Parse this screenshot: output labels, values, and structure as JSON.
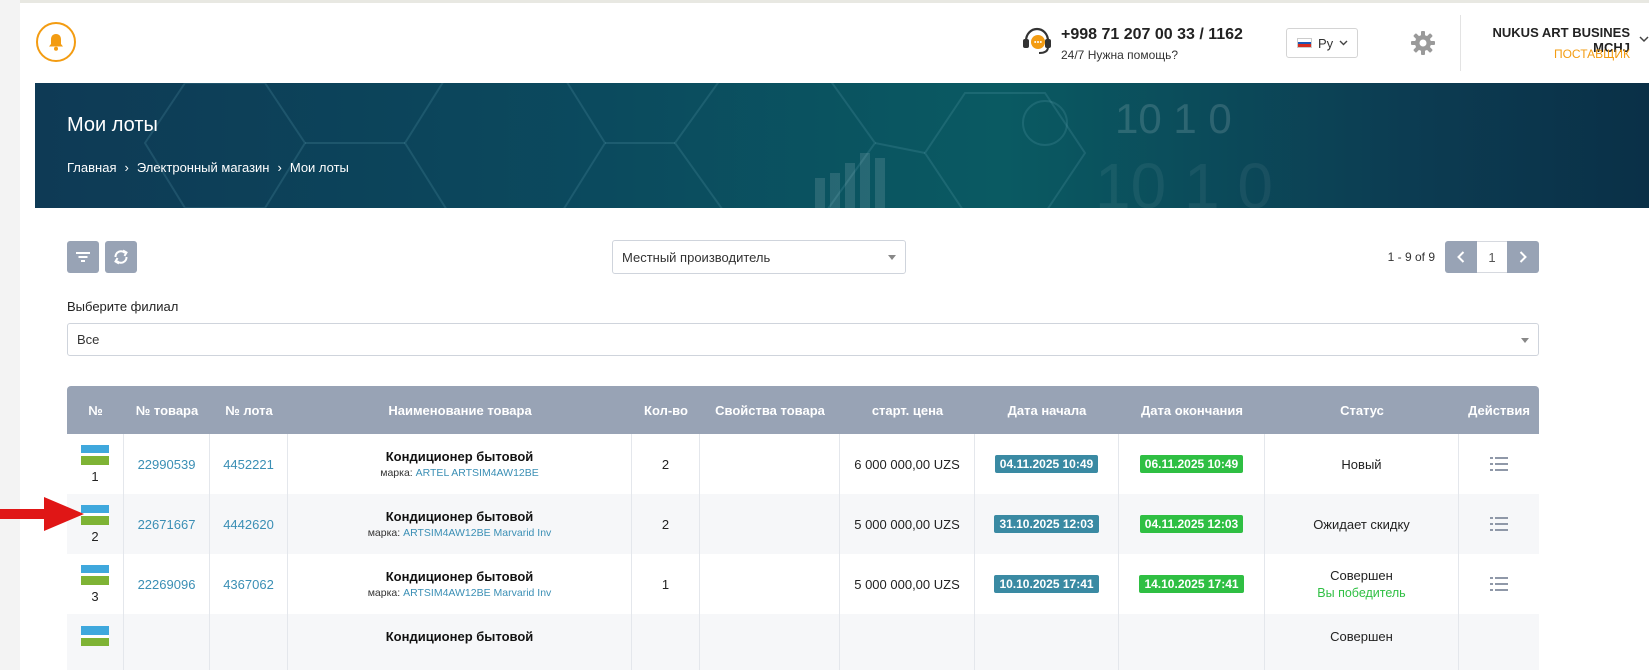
{
  "header": {
    "phone": "+998 71 207 00 33 / 1162",
    "help_text": "24/7 Нужна помощь?",
    "language": "Ру",
    "company": "NUKUS ART BUSINES MCHJ",
    "role": "ПОСТАВЩИК",
    "accent_color": "#f39c12"
  },
  "banner": {
    "title": "Мои лоты",
    "breadcrumbs": [
      "Главная",
      "Электронный магазин",
      "Мои лоты"
    ],
    "separator": "›",
    "decor_digits": "10 1 0"
  },
  "toolbar": {
    "filter_icon": "filter-icon",
    "refresh_icon": "refresh-icon",
    "producer_select": "Местный производитель",
    "pagination_info": "1 - 9 of 9",
    "current_page": "1"
  },
  "branch": {
    "label": "Выберите филиал",
    "value": "Все"
  },
  "table": {
    "columns": [
      "№",
      "№ товара",
      "№ лота",
      "Наименование товара",
      "Кол-во",
      "Свойства товара",
      "старт. цена",
      "Дата начала",
      "Дата окончания",
      "Статус",
      "Действия"
    ],
    "brand_prefix": "марка:",
    "rows": [
      {
        "num": "1",
        "item_no": "22990539",
        "lot_no": "4452221",
        "name": "Кондиционер бытовой",
        "brand": "ARTEL ARTSIM4AW12BE",
        "qty": "2",
        "props": "",
        "price": "6 000 000,00 UZS",
        "start": "04.11.2025 10:49",
        "end": "06.11.2025 10:49",
        "status": "Новый",
        "status_sub": ""
      },
      {
        "num": "2",
        "item_no": "22671667",
        "lot_no": "4442620",
        "name": "Кондиционер бытовой",
        "brand": "ARTSIM4AW12BE Marvarid Inv",
        "qty": "2",
        "props": "",
        "price": "5 000 000,00 UZS",
        "start": "31.10.2025 12:03",
        "end": "04.11.2025 12:03",
        "status": "Ожидает скидку",
        "status_sub": ""
      },
      {
        "num": "3",
        "item_no": "22269096",
        "lot_no": "4367062",
        "name": "Кондиционер бытовой",
        "brand": "ARTSIM4AW12BE Marvarid Inv",
        "qty": "1",
        "props": "",
        "price": "5 000 000,00 UZS",
        "start": "10.10.2025 17:41",
        "end": "14.10.2025 17:41",
        "status": "Совершен",
        "status_sub": "Вы победитель"
      },
      {
        "num": "",
        "item_no": "",
        "lot_no": "",
        "name": "Кондиционер бытовой",
        "brand": "",
        "qty": "",
        "props": "",
        "price": "",
        "start": "",
        "end": "",
        "status": "Совершен",
        "status_sub": ""
      }
    ]
  },
  "colors": {
    "table_header": "#98a3b5",
    "badge_start": "#3a8aa3",
    "badge_end": "#2fbf43",
    "link": "#3b8fb5",
    "arrow": "#e01616"
  }
}
